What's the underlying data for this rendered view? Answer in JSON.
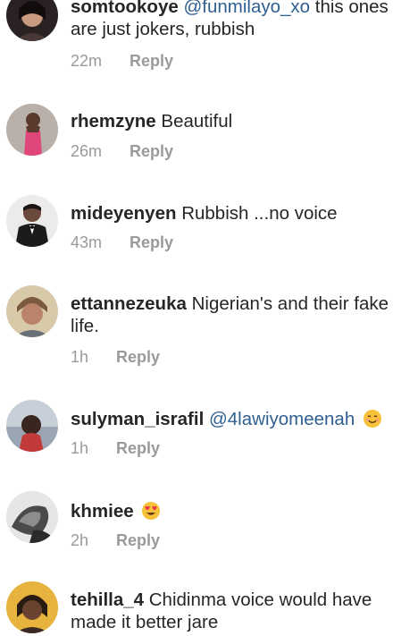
{
  "comments": [
    {
      "username": "somtookoye",
      "mention": "@funmilayo_xo",
      "text": " this ones are just jokers, rubbish",
      "time": "22m",
      "reply": "Reply"
    },
    {
      "username": "rhemzyne",
      "text": " Beautiful",
      "time": "26m",
      "reply": "Reply"
    },
    {
      "username": "mideyenyen",
      "text": " Rubbish ...no voice",
      "time": "43m",
      "reply": "Reply"
    },
    {
      "username": "ettannezeuka",
      "text": " Nigerian's and their fake life.",
      "time": "1h",
      "reply": "Reply"
    },
    {
      "username": "sulyman_israfil",
      "mention": "@4lawiyomeenah",
      "emoji": "smiling-face-emoji",
      "time": "1h",
      "reply": "Reply"
    },
    {
      "username": "khmiee",
      "emoji": "heart-eyes-emoji",
      "time": "2h",
      "reply": "Reply"
    },
    {
      "username": "tehilla_4",
      "text": " Chidinma voice would have made it better jare"
    }
  ],
  "colors": {
    "username": "#262626",
    "mention": "#2f5f90",
    "meta": "#9a9a9a",
    "background": "#ffffff",
    "emoji": "#f7c13a"
  }
}
